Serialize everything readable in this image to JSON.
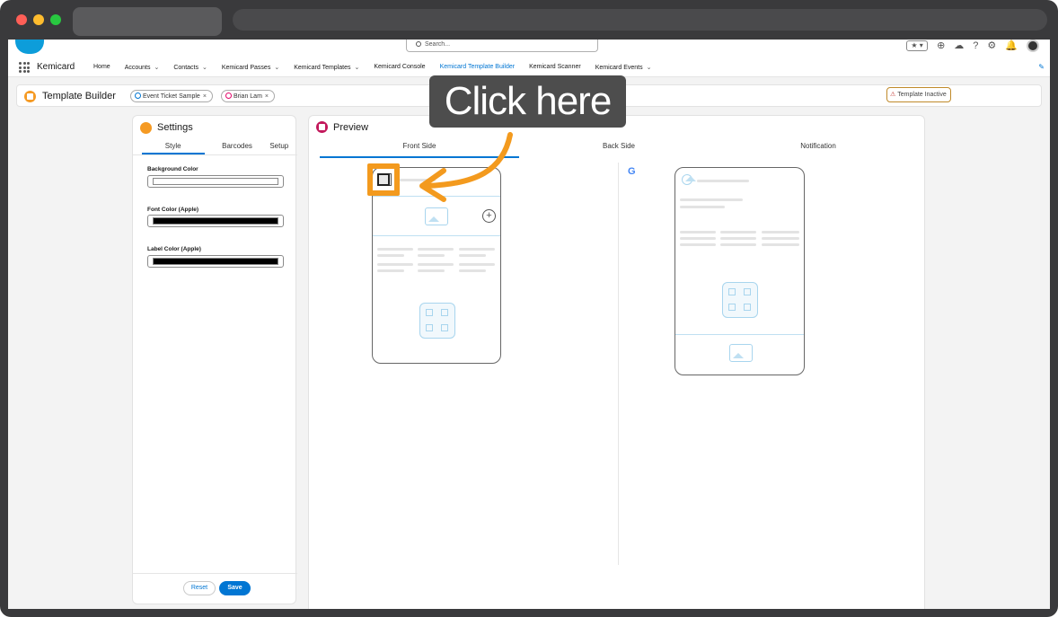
{
  "header": {
    "search_placeholder": "Search...",
    "favorites_label": "★ ▾"
  },
  "nav": {
    "app_name": "Kemicard",
    "items": [
      {
        "label": "Home",
        "dropdown": false
      },
      {
        "label": "Accounts",
        "dropdown": true
      },
      {
        "label": "Contacts",
        "dropdown": true
      },
      {
        "label": "Kemicard Passes",
        "dropdown": true
      },
      {
        "label": "Kemicard Templates",
        "dropdown": true
      },
      {
        "label": "Kemicard Console",
        "dropdown": false
      },
      {
        "label": "Kemicard Template Builder",
        "dropdown": false,
        "active": true
      },
      {
        "label": "Kemicard Scanner",
        "dropdown": false
      },
      {
        "label": "Kemicard Events",
        "dropdown": true
      }
    ]
  },
  "page": {
    "title": "Template Builder",
    "pills": [
      {
        "label": "Event Ticket Sample",
        "remove": "×"
      },
      {
        "label": "Brian Lam",
        "remove": "×"
      }
    ],
    "status_badge": "Template Inactive",
    "status_icon": "⚠"
  },
  "settings": {
    "title": "Settings",
    "tabs": [
      "Style",
      "Barcodes",
      "Setup"
    ],
    "active_tab": "Style",
    "fields": [
      {
        "label": "Background Color",
        "color": "#ffffff"
      },
      {
        "label": "Font Color (Apple)",
        "color": "#000000"
      },
      {
        "label": "Label Color (Apple)",
        "color": "#000000"
      }
    ],
    "reset_label": "Reset",
    "save_label": "Save"
  },
  "preview": {
    "title": "Preview",
    "tabs": [
      "Front Side",
      "Back Side",
      "Notification"
    ],
    "active_tab": "Front Side",
    "apple_glyph": "",
    "google_glyph": "G",
    "plus_glyph": "+"
  },
  "annotation": {
    "callout_text": "Click here",
    "accent_color": "#f39a1e"
  },
  "colors": {
    "brand": "#0176d3",
    "settings_icon": "#f59a23",
    "preview_icon": "#c2185b"
  }
}
